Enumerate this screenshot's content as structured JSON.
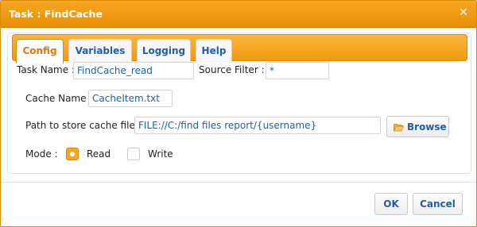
{
  "dialog": {
    "title": "Task : FindCache",
    "close_icon": "close-icon"
  },
  "tabs": [
    {
      "label": "Config",
      "active": true
    },
    {
      "label": "Variables",
      "active": false
    },
    {
      "label": "Logging",
      "active": false
    },
    {
      "label": "Help",
      "active": false
    }
  ],
  "form": {
    "task_name_label": "Task Name :",
    "task_name_value": "FindCache_read",
    "source_filter_label": "Source Filter :",
    "source_filter_value": "*",
    "cache_name_label": "Cache Name :",
    "cache_name_value": "CacheItem.txt",
    "path_label": "Path to store cache file :",
    "path_value": "FILE://C:/find files report/{username}",
    "browse_label": "Browse",
    "browse_icon": "folder-open-icon",
    "mode_label": "Mode :",
    "mode_options": [
      {
        "label": "Read",
        "checked": true
      },
      {
        "label": "Write",
        "checked": false
      }
    ]
  },
  "footer": {
    "ok_label": "OK",
    "cancel_label": "Cancel"
  },
  "colors": {
    "accent": "#f6a623",
    "link": "#1d5fa8",
    "active_tab_text": "#e0790a"
  }
}
